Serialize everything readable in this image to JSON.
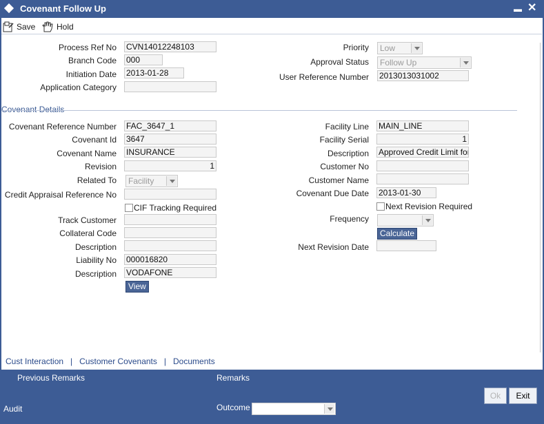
{
  "window": {
    "title": "Covenant Follow Up",
    "minimize": "▬",
    "close": "✕"
  },
  "toolbar": {
    "save_label": "Save",
    "hold_label": "Hold"
  },
  "header": {
    "process_ref_no": {
      "label": "Process Ref No",
      "value": "CVN14012248103"
    },
    "branch_code": {
      "label": "Branch Code",
      "value": "000"
    },
    "initiation_date": {
      "label": "Initiation Date",
      "value": "2013-01-28"
    },
    "application_category": {
      "label": "Application Category",
      "value": ""
    },
    "priority": {
      "label": "Priority",
      "value": "Low"
    },
    "approval_status": {
      "label": "Approval Status",
      "value": "Follow Up"
    },
    "user_reference_number": {
      "label": "User Reference Number",
      "value": "2013013031002"
    }
  },
  "covenant_details": {
    "section_title": "Covenant Details",
    "covenant_reference_number": {
      "label": "Covenant Reference Number",
      "value": "FAC_3647_1"
    },
    "covenant_id": {
      "label": "Covenant Id",
      "value": "3647"
    },
    "covenant_name": {
      "label": "Covenant Name",
      "value": "INSURANCE"
    },
    "revision": {
      "label": "Revision",
      "value": "1"
    },
    "related_to": {
      "label": "Related To",
      "value": "Facility"
    },
    "credit_appraisal_reference_no": {
      "label": "Credit Appraisal Reference No",
      "value": ""
    },
    "cif_tracking_required": {
      "label": "CIF Tracking Required",
      "checked": false
    },
    "track_customer": {
      "label": "Track Customer",
      "value": ""
    },
    "collateral_code": {
      "label": "Collateral Code",
      "value": ""
    },
    "description_1": {
      "label": "Description",
      "value": ""
    },
    "liability_no": {
      "label": "Liability No",
      "value": "000016820"
    },
    "description_2": {
      "label": "Description",
      "value": "VODAFONE"
    },
    "view_button": "View",
    "facility_line": {
      "label": "Facility Line",
      "value": "MAIN_LINE"
    },
    "facility_serial": {
      "label": "Facility Serial",
      "value": "1"
    },
    "description_right": {
      "label": "Description",
      "value": "Approved Credit Limit for"
    },
    "customer_no": {
      "label": "Customer No",
      "value": ""
    },
    "customer_name": {
      "label": "Customer Name",
      "value": ""
    },
    "covenant_due_date": {
      "label": "Covenant Due Date",
      "value": "2013-01-30"
    },
    "next_revision_required": {
      "label": "Next Revision Required",
      "checked": false
    },
    "frequency": {
      "label": "Frequency",
      "value": ""
    },
    "calculate_button": "Calculate",
    "next_revision_date": {
      "label": "Next Revision Date",
      "value": ""
    }
  },
  "links": {
    "cust_interaction": "Cust Interaction",
    "separator": "|",
    "customer_covenants": "Customer Covenants",
    "documents": "Documents"
  },
  "footer": {
    "previous_remarks": "Previous Remarks",
    "remarks": "Remarks",
    "audit": "Audit",
    "outcome": "Outcome",
    "ok": "Ok",
    "exit": "Exit"
  },
  "colors": {
    "titlebar": "#3d5c95",
    "section_title": "#3d5c95",
    "button_blue": "#4a6596"
  }
}
